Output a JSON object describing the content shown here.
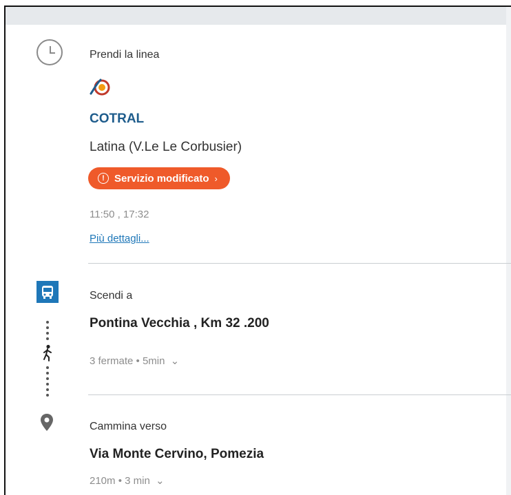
{
  "step1": {
    "header": "Prendi la linea",
    "operator": "COTRAL",
    "destination": "Latina (V.Le Le Corbusier)",
    "badge": "Servizio modificato",
    "times": "11:50 , 17:32",
    "more_link": "Più dettagli...",
    "operator_color": "#1e5c8c",
    "badge_color": "#ef5a2a"
  },
  "step2": {
    "header": "Scendi a",
    "stop": "Pontina Vecchia , Km 32 .200",
    "summary": "3 fermate • 5min",
    "bus_color": "#1e77b8"
  },
  "step3": {
    "header": "Cammina verso",
    "place": "Via Monte Cervino, Pomezia",
    "summary": "210m • 3 min"
  },
  "icons": {
    "clock": "clock-icon",
    "logo": "cotral-logo-icon",
    "alert": "alert-icon",
    "bus": "bus-icon",
    "walk": "walking-person-icon",
    "pin": "location-pin-icon",
    "chevron": "chevron-down-icon"
  }
}
